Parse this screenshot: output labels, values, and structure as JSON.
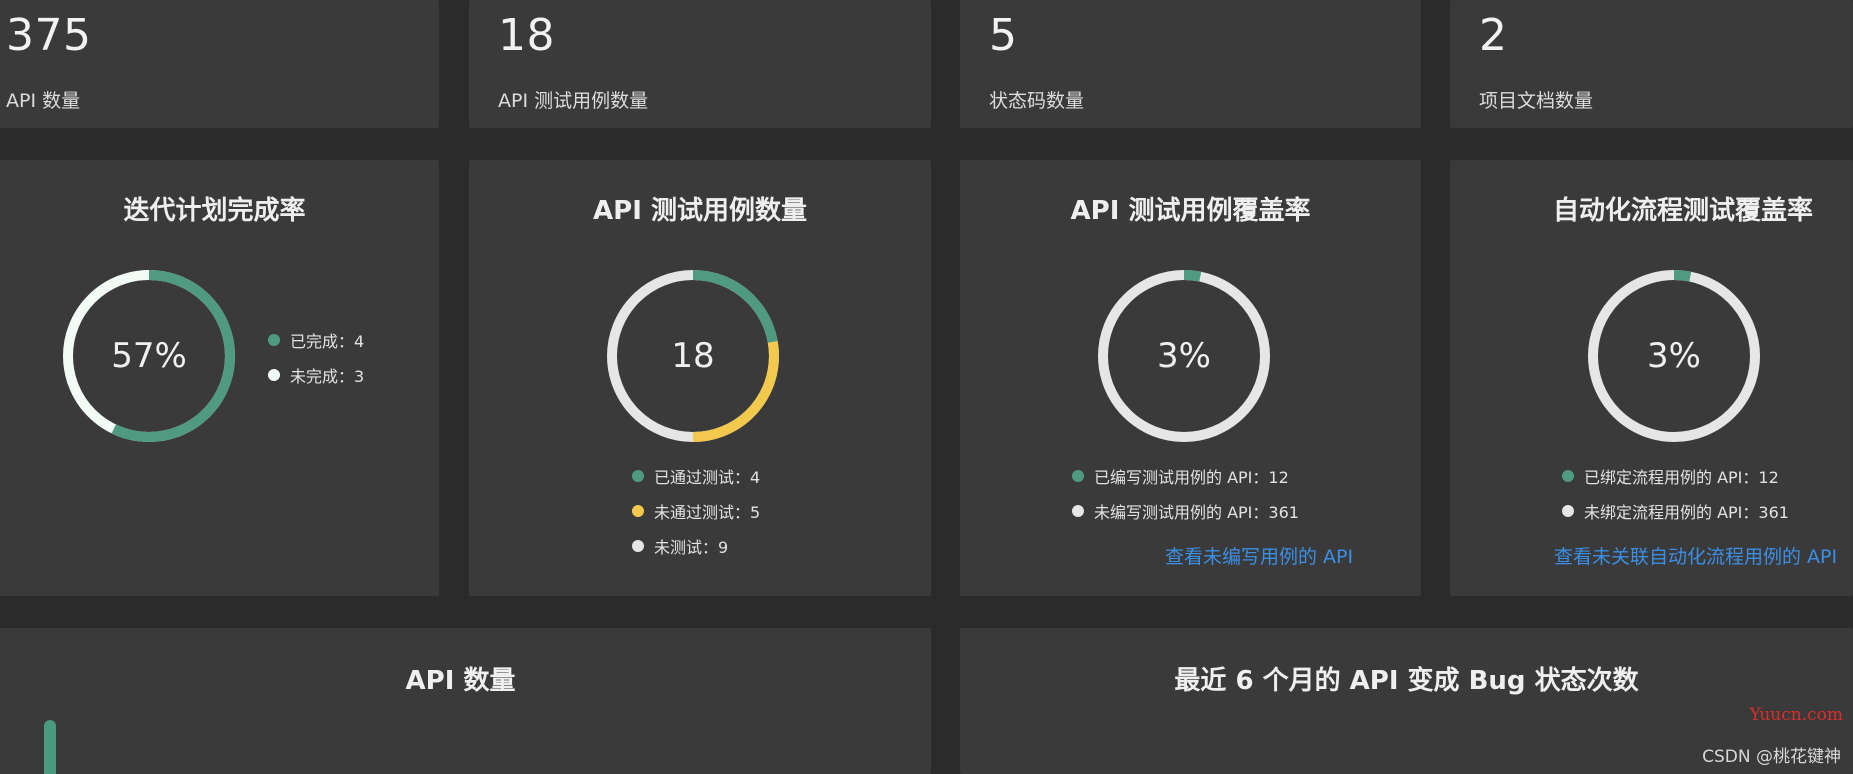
{
  "stats": [
    {
      "value": "375",
      "label": "API 数量"
    },
    {
      "value": "18",
      "label": "API 测试用例数量"
    },
    {
      "value": "5",
      "label": "状态码数量"
    },
    {
      "value": "2",
      "label": "项目文档数量"
    }
  ],
  "charts": [
    {
      "title": "迭代计划完成率",
      "center": "57%",
      "legend": [
        {
          "label": "已完成：4",
          "color": "#4f9a80"
        },
        {
          "label": "未完成：3",
          "color": "#f3fbf7"
        }
      ]
    },
    {
      "title": "API 测试用例数量",
      "center": "18",
      "legend": [
        {
          "label": "已通过测试：4",
          "color": "#4f9a80"
        },
        {
          "label": "未通过测试：5",
          "color": "#f2c94c"
        },
        {
          "label": "未测试：9",
          "color": "#e6e6e6"
        }
      ]
    },
    {
      "title": "API 测试用例覆盖率",
      "center": "3%",
      "legend": [
        {
          "label": "已编写测试用例的 API：12",
          "color": "#4f9a80"
        },
        {
          "label": "未编写测试用例的 API：361",
          "color": "#e6e6e6"
        }
      ],
      "link": "查看未编写用例的 API"
    },
    {
      "title": "自动化流程测试覆盖率",
      "center": "3%",
      "legend": [
        {
          "label": "已绑定流程用例的 API：12",
          "color": "#4f9a80"
        },
        {
          "label": "未绑定流程用例的 API：361",
          "color": "#e6e6e6"
        }
      ],
      "link": "查看未关联自动化流程用例的 API"
    }
  ],
  "bottom": {
    "left_title": "API 数量",
    "right_title": "最近 6 个月的 API 变成 Bug 状态次数"
  },
  "watermarks": {
    "site": "Yuucn.com",
    "author": "CSDN @桃花键神"
  }
}
